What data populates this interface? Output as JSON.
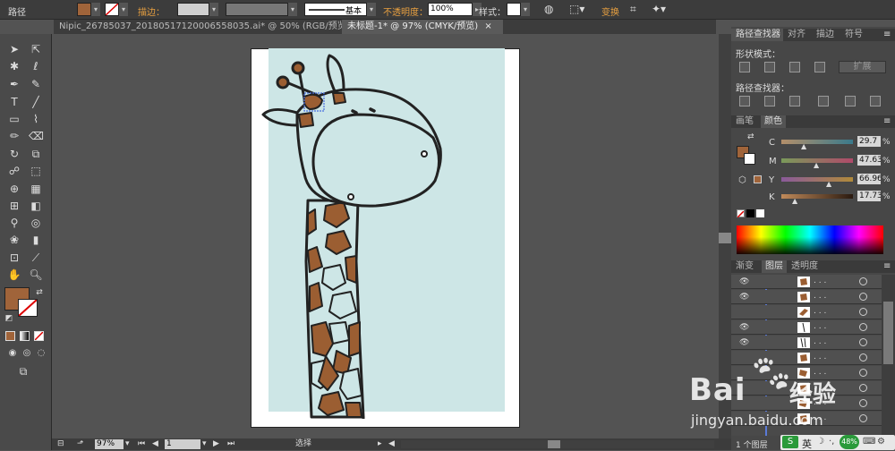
{
  "control_bar": {
    "selection_label": "路径",
    "stroke_label": "描边：",
    "stroke_profile": "基本",
    "opacity_label": "不透明度：",
    "opacity_value": "100%",
    "style_label": "样式：",
    "transform_label": "变换"
  },
  "doc_tabs": [
    {
      "label": "Nipic_26785037_20180517120006558035.ai* @ 50% (RGB/预览)"
    },
    {
      "label": "未标题-1* @ 97% (CMYK/预览)"
    }
  ],
  "status_bar": {
    "zoom": "97%",
    "artboard": "1",
    "tool_name": "选择"
  },
  "panels": {
    "pathfinder": {
      "tabs": [
        "路径查找器",
        "对齐",
        "描边",
        "符号"
      ],
      "shape_modes_label": "形状模式：",
      "expand_label": "扩展",
      "pathfinders_label": "路径查找器："
    },
    "color": {
      "tabs": [
        "画笔",
        "颜色"
      ],
      "channels": [
        {
          "name": "C",
          "value": "29.7",
          "unit": "%"
        },
        {
          "name": "M",
          "value": "47.63",
          "unit": "%"
        },
        {
          "name": "Y",
          "value": "66.96",
          "unit": "%"
        },
        {
          "name": "K",
          "value": "17.73",
          "unit": "%"
        }
      ]
    },
    "layers": {
      "tabs": [
        "渐变",
        "图层",
        "透明度"
      ],
      "row_dots": ". . .",
      "footer": "1 个图层"
    }
  },
  "colors": {
    "fill": "#a0643a",
    "art_bg": "#cde6e6",
    "giraffe_spot": "#9b5e32"
  },
  "ime": {
    "lang": "英",
    "cpu": "48%"
  },
  "watermark": {
    "brand": "Bai",
    "brand2": "经验",
    "url": "jingyan.baidu.com"
  }
}
